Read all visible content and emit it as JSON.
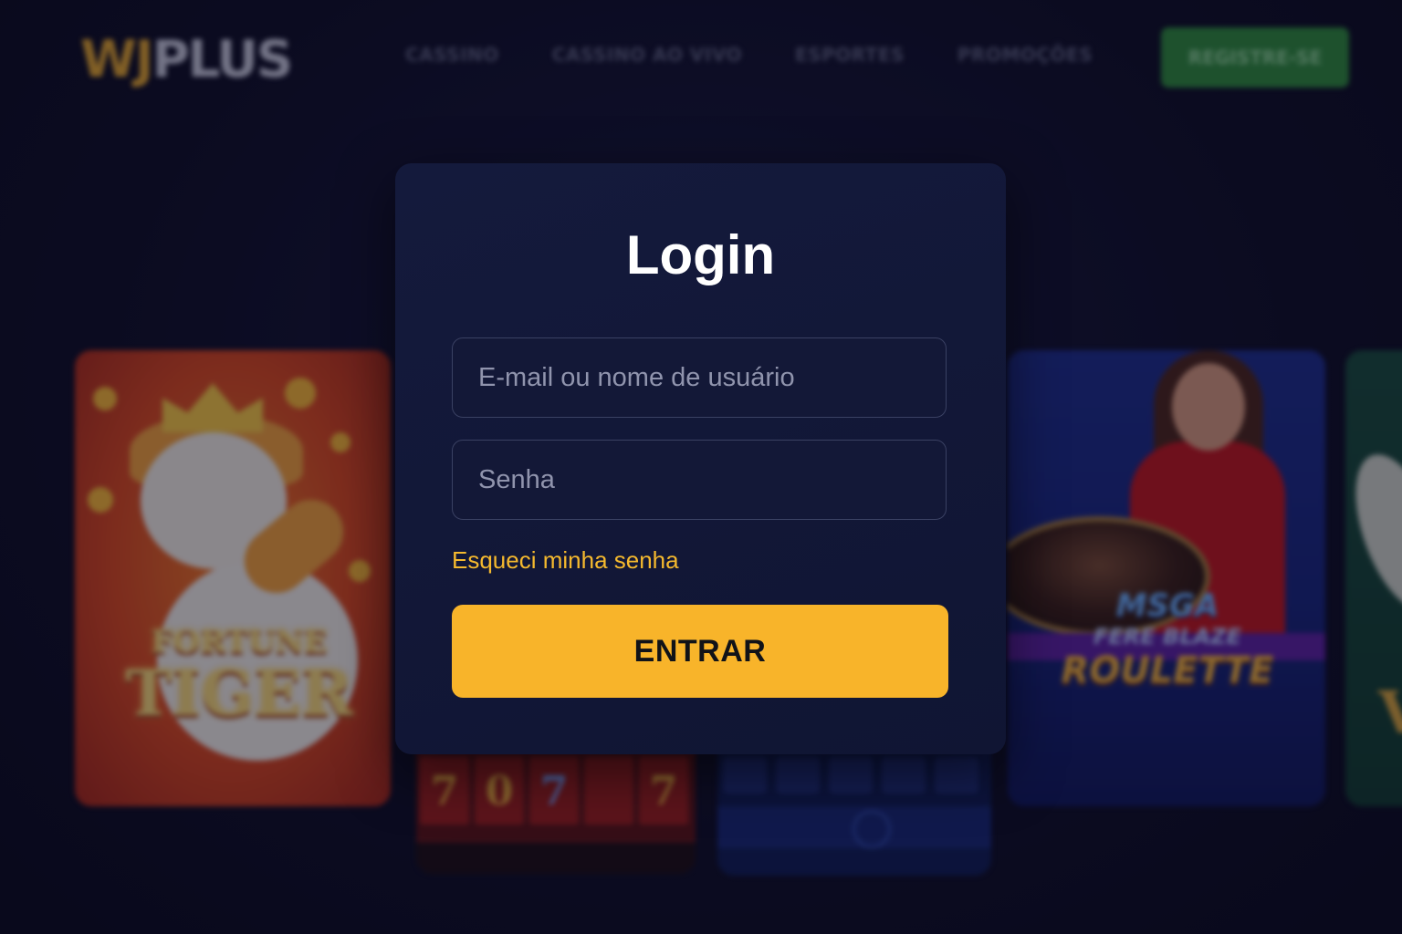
{
  "header": {
    "logo": {
      "part1": "WJ",
      "part2": "PLUS"
    },
    "nav": [
      "CASSINO",
      "CASSINO AO VIVO",
      "ESPORTES",
      "PROMOÇÕES"
    ],
    "register_label": "REGISTRE-SE"
  },
  "games": {
    "tiger": {
      "line1": "FORTUNE",
      "line2": "TIGER"
    },
    "slot_symbols": [
      "7",
      "0",
      "7",
      "",
      "7"
    ],
    "roulette": {
      "line1": "MSGA",
      "line2": "FERE BLAZE",
      "line3": "ROULETTE"
    },
    "green_letter": "V"
  },
  "login": {
    "title": "Login",
    "email_placeholder": "E-mail ou nome de usuário",
    "password_placeholder": "Senha",
    "forgot_password": "Esqueci minha senha",
    "submit_label": "ENTRAR"
  },
  "colors": {
    "background": "#0c0c22",
    "modal": "#121836",
    "accent": "#f8b42a",
    "register": "#2e8b3a"
  }
}
